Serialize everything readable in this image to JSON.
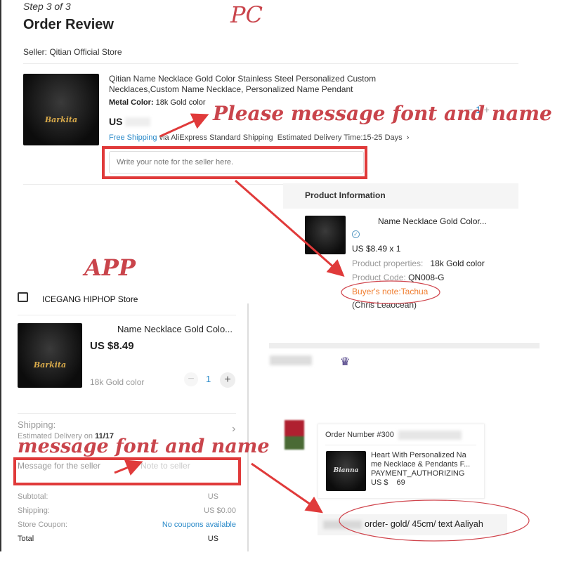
{
  "labels": {
    "pc": "PC",
    "app": "APP",
    "pc_annotation": "Please message font and name",
    "app_annotation": "message font and name"
  },
  "pc": {
    "step": "Step 3 of 3",
    "title": "Order Review",
    "seller": "Seller: Qitian Official Store",
    "product": {
      "title_line1": "Qitian Name Necklace Gold Color Stainless Steel Personalized Custom",
      "title_line2": "Necklaces,Custom Name Necklace, Personalized Name Pendant",
      "metal_label": "Metal Color:",
      "metal_value": "18k Gold color",
      "price_prefix": "US",
      "image_text": "Barkita",
      "qty": "1"
    },
    "shipping": {
      "free": "Free Shipping",
      "via": "via AliExpress Standard Shipping",
      "estimate": "Estimated Delivery Time:15-25 Days"
    },
    "note_placeholder": "Write your note for the seller here."
  },
  "seller_view": {
    "header": "Product Information",
    "name": "Name Necklace Gold Color...",
    "price": "US $8.49 x 1",
    "properties_label": "Product properties:",
    "properties_value": "18k Gold color",
    "code_label": "Product Code:",
    "code_value": "QN008-G",
    "buyer_note": "Buyer's note:Tachua",
    "buyer_name": "(Chris Leaocean)"
  },
  "app": {
    "store": "ICEGANG HIPHOP Store",
    "name": "Name Necklace Gold Colo...",
    "price": "US $8.49",
    "variant": "18k Gold color",
    "qty": "1",
    "image_text": "Barkita",
    "shipping_label": "Shipping:",
    "delivery_prefix": "Estimated Delivery on",
    "delivery_date": "11/17",
    "message_label": "Message for the seller",
    "message_placeholder": "Note to seller",
    "summary": [
      {
        "label": "Subtotal:",
        "value": "US"
      },
      {
        "label": "Shipping:",
        "value": "US $0.00"
      },
      {
        "label": "Store Coupon:",
        "value": "No coupons available"
      },
      {
        "label": "Total",
        "value": "US"
      }
    ]
  },
  "chat": {
    "order_number": "Order Number #300",
    "product_line1": "Heart With Personalized Na",
    "product_line2": "me Necklace & Pendants F...",
    "status": "PAYMENT_AUTHORIZING",
    "price": "US $",
    "price_suffix": "69",
    "image_text": "Bianna",
    "message": "order- gold/ 45cm/ text Aaliyah"
  },
  "colors": {
    "annotation": "#e03a3a",
    "link": "#2a8ac9",
    "note": "#f07d2f",
    "crown": "#3d2d7a"
  }
}
